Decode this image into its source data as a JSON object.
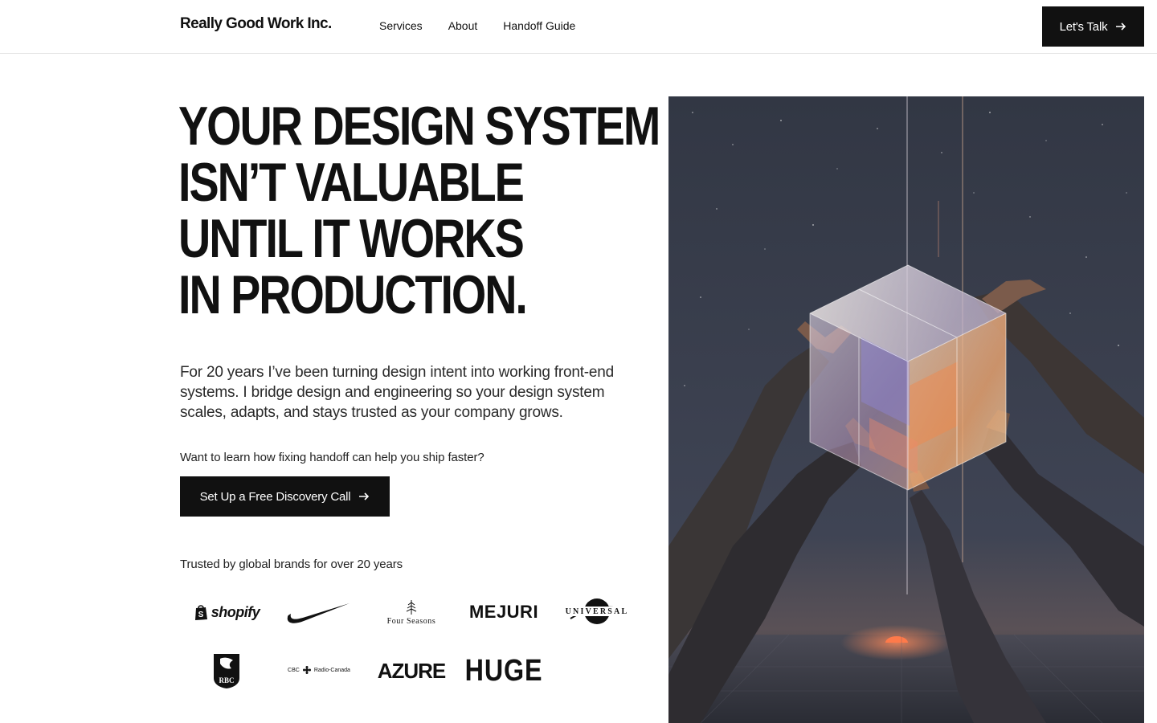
{
  "header": {
    "brand": "Really Good Work Inc.",
    "nav": [
      "Services",
      "About",
      "Handoff Guide"
    ],
    "cta_label": "Let's Talk"
  },
  "hero": {
    "headline_lines": [
      "YOUR DESIGN SYSTEM",
      "ISN’T VALUABLE",
      "UNTIL IT WORKS",
      "IN PRODUCTION."
    ],
    "lead": "For 20 years I’ve been turning design intent into working front-end systems. I bridge design and engineering so your design system scales, adapts, and stays trusted as your company grows.",
    "prompt": "Want to learn how fixing handoff can help you ship faster?",
    "cta_label": "Set Up a Free Discovery Call",
    "trusted_label": "Trusted by global brands for over 20 years"
  },
  "logos": {
    "shopify": "shopify",
    "nike": "nike-swoosh",
    "four_seasons": "Four Seasons",
    "mejuri": "MEJURI",
    "universal": "UNIVERSAL",
    "rbc": "RBC",
    "cbc_left": "CBC",
    "cbc_right": "Radio-Canada",
    "azure": "AZURE",
    "huge": "HUGE"
  },
  "icons": {
    "cta_arrow": "arrow-right-icon"
  },
  "colors": {
    "text": "#111111",
    "button_bg": "#111111",
    "button_text": "#ffffff",
    "border": "#e6e6e6"
  }
}
